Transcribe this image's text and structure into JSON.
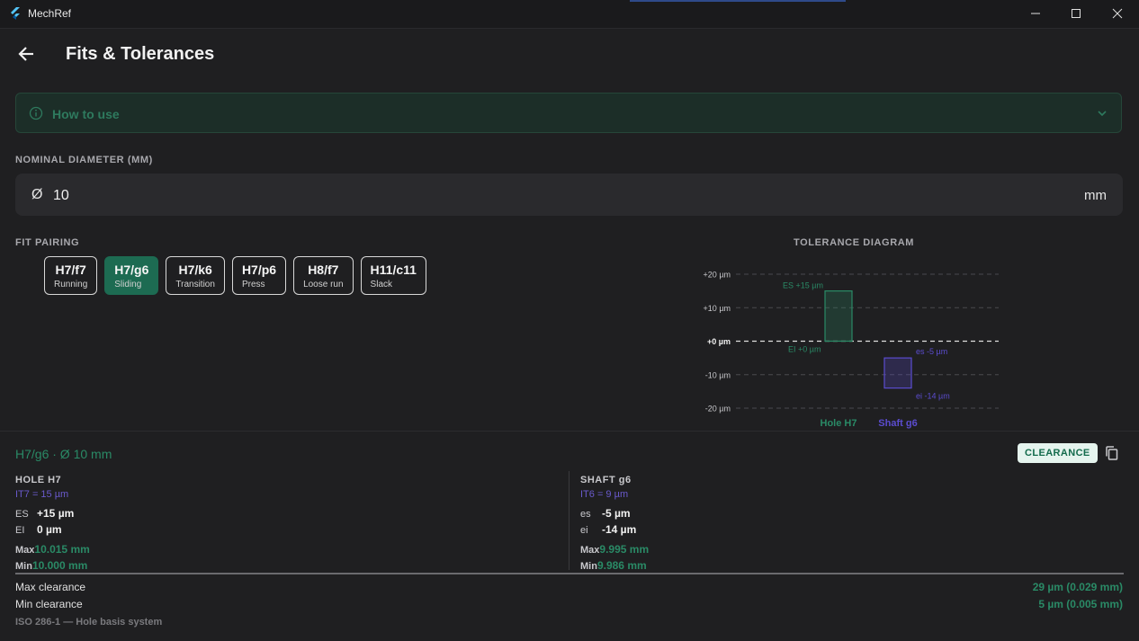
{
  "window": {
    "title": "MechRef"
  },
  "appbar": {
    "title": "Fits & Tolerances"
  },
  "how_to_use": {
    "label": "How to use"
  },
  "nominal": {
    "label": "NOMINAL DIAMETER (MM)",
    "prefix": "Ø",
    "value": "10",
    "suffix": "mm"
  },
  "fit_pairing": {
    "label": "FIT PAIRING",
    "selected_index": 1,
    "options": [
      {
        "code": "H7/f7",
        "desc": "Running"
      },
      {
        "code": "H7/g6",
        "desc": "Sliding"
      },
      {
        "code": "H7/k6",
        "desc": "Transition"
      },
      {
        "code": "H7/p6",
        "desc": "Press"
      },
      {
        "code": "H8/f7",
        "desc": "Loose run"
      },
      {
        "code": "H11/c11",
        "desc": "Slack"
      }
    ]
  },
  "diagram": {
    "title": "TOLERANCE DIAGRAM",
    "ticks": [
      "+20 µm",
      "+10 µm",
      "+0 µm",
      "-10 µm",
      "-20 µm"
    ],
    "hole_upper_label": "ES +15 µm",
    "hole_lower_label": "EI +0 µm",
    "shaft_upper_label": "es -5 µm",
    "shaft_lower_label": "ei -14 µm",
    "hole_label": "Hole H7",
    "shaft_label": "Shaft g6",
    "colors": {
      "hole": "#2a8a66",
      "shaft": "#5b4ccf"
    },
    "chart_data": {
      "type": "bar",
      "ylim": [
        -20,
        20
      ],
      "series": [
        {
          "name": "Hole H7",
          "upper": 15,
          "lower": 0
        },
        {
          "name": "Shaft g6",
          "upper": -5,
          "lower": -14
        }
      ]
    }
  },
  "result": {
    "title": "H7/g6  ·  Ø 10 mm",
    "badge": "CLEARANCE",
    "hole": {
      "head": "HOLE  H7",
      "it": "IT7 = 15 µm",
      "upper_key": "ES",
      "upper_val": "+15 µm",
      "lower_key": "EI",
      "lower_val": "0 µm",
      "max_key": "Max",
      "max_val": "10.015 mm",
      "min_key": "Min",
      "min_val": "10.000 mm"
    },
    "shaft": {
      "head": "SHAFT  g6",
      "it": "IT6 = 9 µm",
      "upper_key": "es",
      "upper_val": "-5 µm",
      "lower_key": "ei",
      "lower_val": "-14 µm",
      "max_key": "Max",
      "max_val": "9.995 mm",
      "min_key": "Min",
      "min_val": "9.986 mm"
    },
    "max_clearance_label": "Max clearance",
    "max_clearance_val": "29 µm  (0.029 mm)",
    "min_clearance_label": "Min clearance",
    "min_clearance_val": "5 µm  (0.005 mm)",
    "footnote": "ISO 286-1 — Hole basis system"
  }
}
